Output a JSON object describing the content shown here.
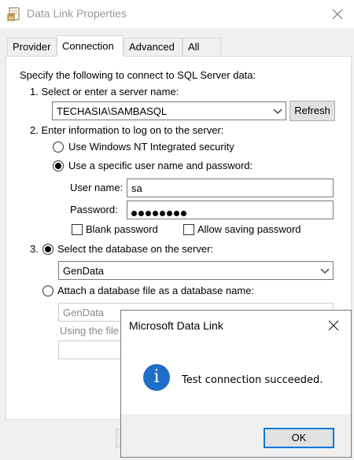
{
  "window": {
    "title": "Data Link Properties",
    "app_icon": "data-link-icon",
    "close_icon": "close-icon"
  },
  "tabs": [
    {
      "label": "Provider",
      "active": false
    },
    {
      "label": "Connection",
      "active": true
    },
    {
      "label": "Advanced",
      "active": false
    },
    {
      "label": "All",
      "active": false
    }
  ],
  "connection": {
    "intro": "Specify the following to connect to SQL Server data:",
    "step1": {
      "label": "1. Select or enter a server name:",
      "server_value": "TECHASIA\\SAMBASQL",
      "refresh_label": "Refresh"
    },
    "step2": {
      "label": "2. Enter information to log on to the server:",
      "radio_nt": "Use Windows NT Integrated security",
      "radio_specific": "Use a specific user name and password:",
      "selected": "specific",
      "username_label": "User name:",
      "username_value": "sa",
      "password_label": "Password:",
      "password_mask_length": 8,
      "blank_password_label": "Blank password",
      "blank_password_checked": false,
      "allow_saving_label": "Allow saving password",
      "allow_saving_checked": false
    },
    "step3": {
      "number": "3.",
      "radio_select_db": "Select the database on the server:",
      "database_value": "GenData",
      "radio_attach": "Attach a database file as a database name:",
      "selected": "select_db",
      "attach_name_value": "GenData",
      "using_file_label": "Using the file"
    }
  },
  "message_box": {
    "title": "Microsoft Data Link",
    "close_icon": "close-icon",
    "icon": "info-icon",
    "message": "Test connection succeeded.",
    "ok_label": "OK"
  },
  "colors": {
    "accent": "#0078d7",
    "info_icon": "#1f6ec7",
    "dialog_bg": "#f0f0f0"
  }
}
